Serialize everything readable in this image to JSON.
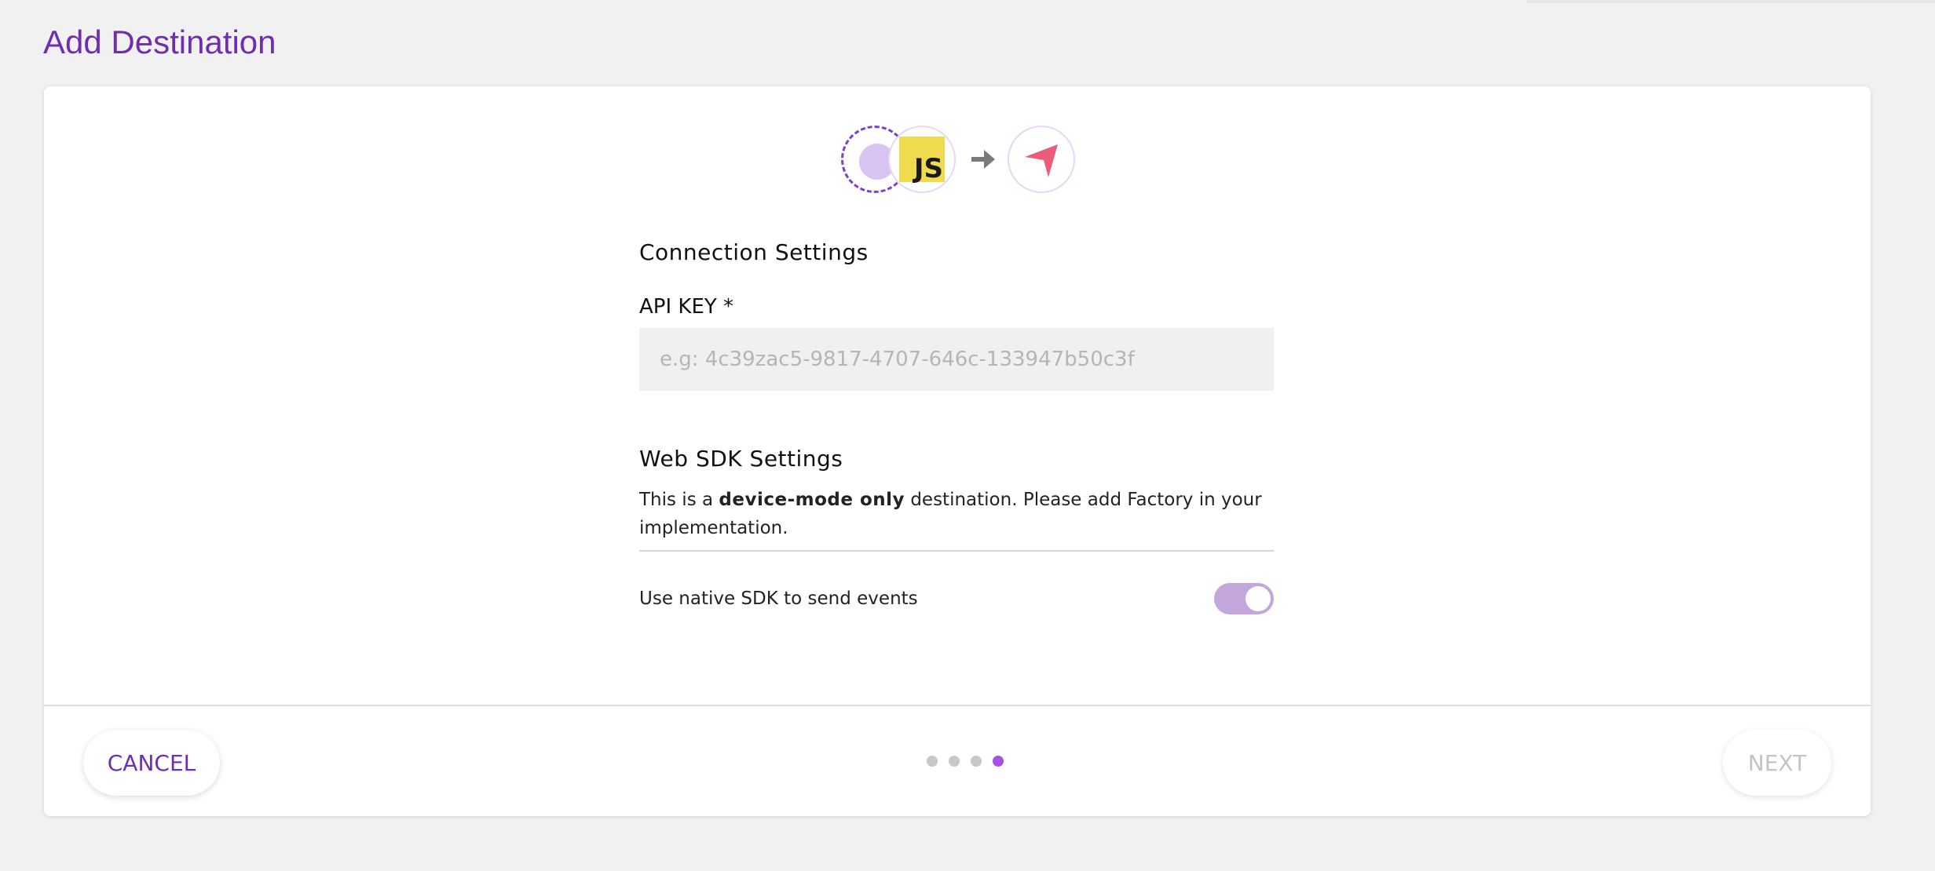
{
  "page": {
    "title": "Add Destination"
  },
  "icons": {
    "source": "source-placeholder-icon",
    "source_sdk": "JS",
    "arrow": "arrow-right-icon",
    "destination": "destination-logo-icon"
  },
  "connection": {
    "title": "Connection Settings",
    "api_key_label": "API KEY *",
    "api_key_value": "",
    "api_key_placeholder": "e.g: 4c39zac5-9817-4707-646c-133947b50c3f"
  },
  "web_sdk": {
    "title": "Web SDK Settings",
    "desc_prefix": "This is a ",
    "desc_bold": "device-mode only",
    "desc_suffix": " destination. Please add Factory in your implementation.",
    "toggle_label": "Use native SDK to send events",
    "toggle_on": true
  },
  "footer": {
    "cancel_label": "CANCEL",
    "next_label": "NEXT",
    "steps_total": 4,
    "current_step": 4
  },
  "colors": {
    "accent": "#6f2eb0",
    "toggle_track": "#c2a6dc",
    "step_active": "#a84fe6",
    "js_badge": "#f0db4f",
    "destination_logo": "#ec5b7a"
  }
}
